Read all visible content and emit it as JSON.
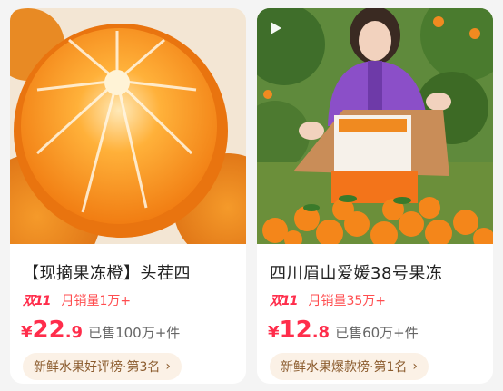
{
  "products": [
    {
      "title": "【现摘果冻橙】头茬四",
      "promo_badge": "双11",
      "monthly_sales": "月销量1万+",
      "price_symbol": "¥",
      "price_int": "22",
      "price_dec": ".9",
      "sold_count": "已售100万+件",
      "rank_label": "新鲜水果好评榜·第3名",
      "has_video": false,
      "colors": {
        "accent": "#ff2d4b",
        "fruit": "#f58a1f"
      }
    },
    {
      "title": "四川眉山爱媛38号果冻",
      "promo_badge": "双11",
      "monthly_sales": "月销量35万+",
      "price_symbol": "¥",
      "price_int": "12",
      "price_dec": ".8",
      "sold_count": "已售60万+件",
      "rank_label": "新鲜水果爆款榜·第1名",
      "has_video": true,
      "colors": {
        "accent": "#ff2d4b",
        "jacket": "#8b4fc8"
      }
    }
  ],
  "icons": {
    "play": "play-icon",
    "chevron": "chevron-right-icon"
  },
  "chevron_glyph": "›"
}
